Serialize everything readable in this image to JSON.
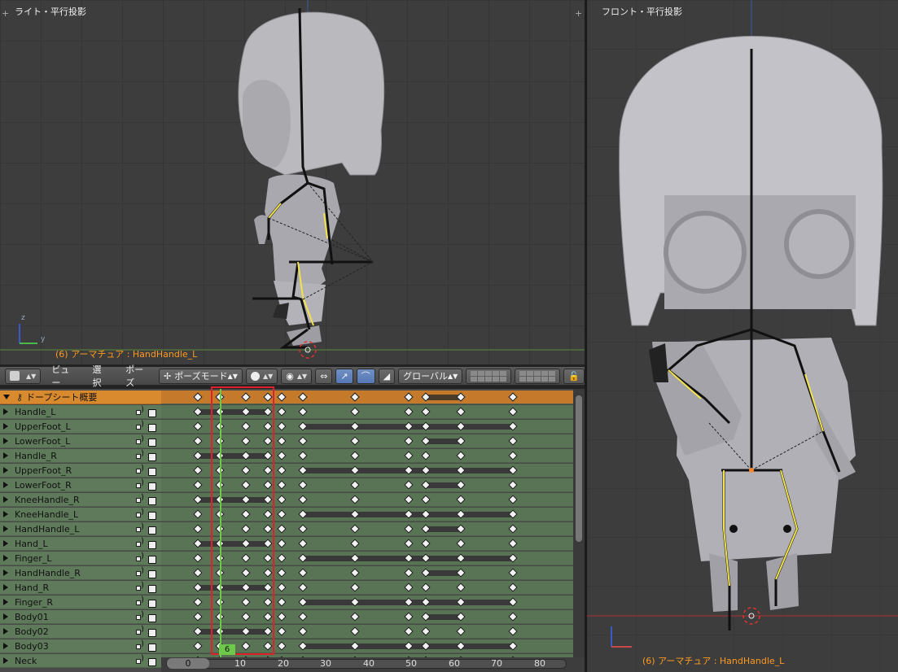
{
  "left_viewport": {
    "title": "ライト・平行投影",
    "status": "(6) アーマチュア : HandHandle_L",
    "axis_z": "z",
    "axis_y": "y"
  },
  "right_viewport": {
    "title": "フロント・平行投影",
    "status": "(6) アーマチュア : HandHandle_L"
  },
  "header": {
    "menus": [
      "ビュー",
      "選択",
      "ポーズ"
    ],
    "mode": "ポーズモード",
    "orientation": "グローバル"
  },
  "dopesheet": {
    "summary_label": "ドープシート概要",
    "current_frame": "6",
    "channels": [
      "Handle_L",
      "UpperFoot_L",
      "LowerFoot_L",
      "Handle_R",
      "UpperFoot_R",
      "LowerFoot_R",
      "KneeHandle_R",
      "KneeHandle_L",
      "HandHandle_L",
      "Hand_L",
      "Finger_L",
      "HandHandle_R",
      "Hand_R",
      "Finger_R",
      "Body01",
      "Body02",
      "Body03",
      "Neck"
    ],
    "ruler_labels": [
      "0",
      "10",
      "20",
      "30",
      "40",
      "50",
      "60",
      "70",
      "80"
    ]
  },
  "colors": {
    "status_text": "#ff9a1e",
    "summary_row": "#d98a2e",
    "channel_row": "#5e7a5a",
    "current_frame": "#6ec94a",
    "highlight_box": "#e0202a"
  }
}
